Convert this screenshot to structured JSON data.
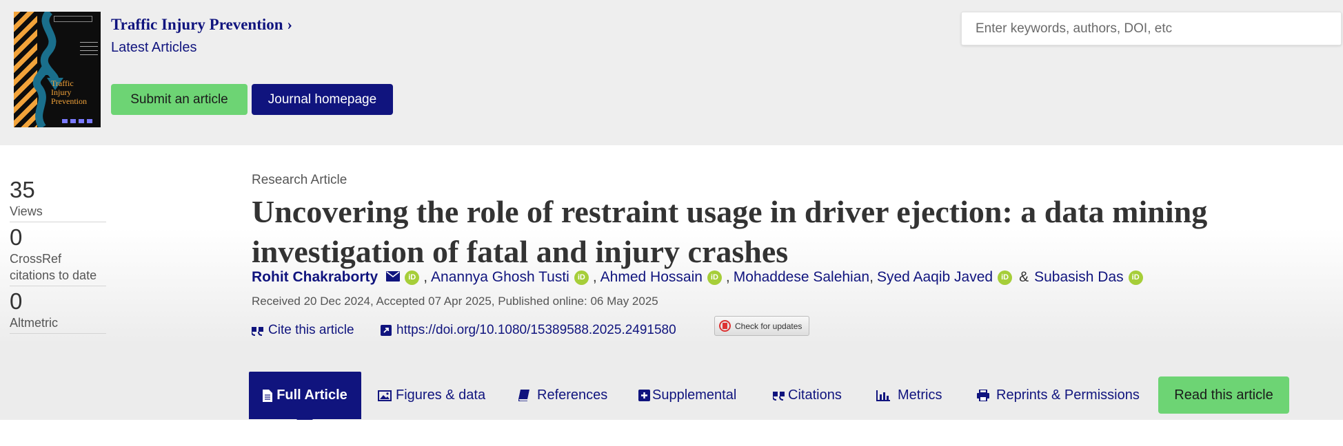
{
  "header": {
    "journal_title": "Traffic Injury Prevention",
    "journal_chevron": "›",
    "latest_link": "Latest Articles",
    "submit_label": "Submit an article",
    "homepage_label": "Journal homepage",
    "search_placeholder": "Enter keywords, authors, DOI, etc",
    "cover": {
      "title_line1": "Traffic",
      "title_line2": "Injury",
      "title_line3": "Prevention"
    }
  },
  "metrics": [
    {
      "value": "35",
      "label": "Views"
    },
    {
      "value": "0",
      "label": "CrossRef citations to date"
    },
    {
      "value": "0",
      "label": "Altmetric"
    }
  ],
  "article": {
    "type": "Research Article",
    "title": "Uncovering the role of restraint usage in driver ejection: a data mining investigation of fatal and injury crashes",
    "authors": [
      "Rohit Chakraborty",
      "Anannya Ghosh Tusti",
      "Ahmed Hossain",
      "Mohaddese Salehian",
      "Syed Aaqib Javed",
      "Subasish Das"
    ],
    "separator": ",",
    "ampersand": "&",
    "dates": "Received 20 Dec 2024, Accepted 07 Apr 2025, Published online: 06 May 2025",
    "cite_label": "Cite this article",
    "doi": "https://doi.org/10.1080/15389588.2025.2491580",
    "check_updates": "Check for updates"
  },
  "tabs": {
    "full_article": "Full Article",
    "figures": "Figures & data",
    "references": "References",
    "supplemental": "Supplemental",
    "citations": "Citations",
    "metrics": "Metrics",
    "reprints": "Reprints & Permissions",
    "read": "Read this article"
  },
  "colors": {
    "brand_navy": "#10147e",
    "accent_green": "#6dd474",
    "orcid_green": "#a6ce39",
    "header_bg": "#eeeeee"
  },
  "icons": [
    "envelope-icon",
    "orcid-icon",
    "quote-icon",
    "external-link-icon",
    "file-icon",
    "image-icon",
    "book-icon",
    "plus-square-icon",
    "bar-chart-icon",
    "print-icon"
  ]
}
